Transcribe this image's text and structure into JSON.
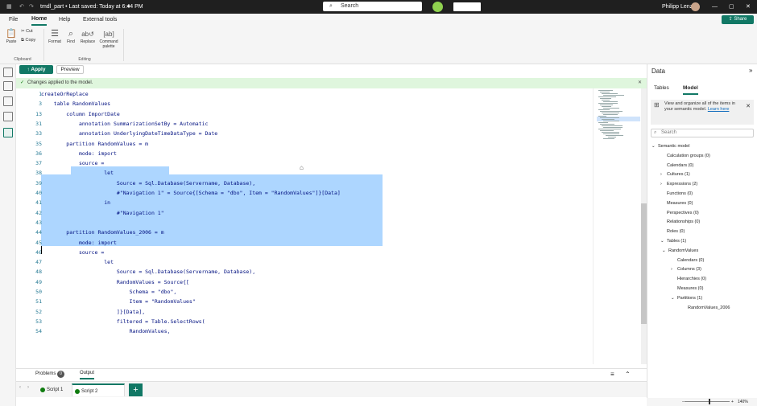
{
  "titlebar": {
    "doc_title": "tmdl_part • Last saved: Today at 6:44 PM",
    "search_placeholder": "Search",
    "user": "Philipp Lenz",
    "share": "Share"
  },
  "menu": [
    "File",
    "Home",
    "Help",
    "External tools"
  ],
  "ribbon": {
    "paste": "Paste",
    "cut": "Cut",
    "copy": "Copy",
    "format": "Format",
    "find": "Find",
    "replace": "Replace",
    "command_palette": "Command palette",
    "group_clipboard": "Clipboard",
    "group_editing": "Editing"
  },
  "toolbar": {
    "apply": "Apply",
    "preview": "Preview"
  },
  "banner": "Changes applied to the model.",
  "code_lines": [
    {
      "n": "1",
      "t": "createOrReplace"
    },
    {
      "n": "3",
      "t": "    table RandomValues"
    },
    {
      "n": "13",
      "t": "        column ImportDate"
    },
    {
      "n": "31",
      "t": "            annotation SummarizationSetBy = Automatic"
    },
    {
      "n": "33",
      "t": "            annotation UnderlyingDateTimeDataType = Date"
    },
    {
      "n": "35",
      "t": "        partition RandomValues = m"
    },
    {
      "n": "36",
      "t": "            mode: import"
    },
    {
      "n": "37",
      "t": "            source ="
    },
    {
      "n": "38",
      "t": "                    let"
    },
    {
      "n": "39",
      "t": "                        Source = Sql.Database(Servername, Database),"
    },
    {
      "n": "40",
      "t": "                        #\"Navigation 1\" = Source{[Schema = \"dbo\", Item = \"RandomValues\"]}[Data]"
    },
    {
      "n": "41",
      "t": "                    in"
    },
    {
      "n": "42",
      "t": "                        #\"Navigation 1\""
    },
    {
      "n": "43",
      "t": ""
    },
    {
      "n": "44",
      "t": "        partition RandomValues_2006 = m"
    },
    {
      "n": "45",
      "t": "            mode: import"
    },
    {
      "n": "46",
      "t": "            source ="
    },
    {
      "n": "47",
      "t": "                    let"
    },
    {
      "n": "48",
      "t": "                        Source = Sql.Database(Servername, Database),"
    },
    {
      "n": "49",
      "t": "                        RandomValues = Source{["
    },
    {
      "n": "50",
      "t": "                            Schema = \"dbo\","
    },
    {
      "n": "51",
      "t": "                            Item = \"RandomValues\""
    },
    {
      "n": "52",
      "t": "                        ]}[Data],"
    },
    {
      "n": "53",
      "t": "                        filtered = Table.SelectRows("
    },
    {
      "n": "54",
      "t": "                            RandomValues,"
    }
  ],
  "output_tabs": {
    "problems": "Problems",
    "problems_count": "0",
    "output": "Output"
  },
  "script_tabs": [
    "Script 1",
    "Script 2"
  ],
  "data_pane": {
    "title": "Data",
    "tab_tables": "Tables",
    "tab_model": "Model",
    "info": "View and organize all of the items in your semantic model.",
    "learn_here": "Learn here",
    "search_placeholder": "Search",
    "tree": [
      {
        "label": "Semantic model",
        "level": 0,
        "arrow": "v"
      },
      {
        "label": "Calculation groups (0)",
        "level": 1,
        "arrow": ""
      },
      {
        "label": "Calendars (0)",
        "level": 1,
        "arrow": ""
      },
      {
        "label": "Cultures (1)",
        "level": 1,
        "arrow": ">"
      },
      {
        "label": "Expressions (2)",
        "level": 1,
        "arrow": ">"
      },
      {
        "label": "Functions (0)",
        "level": 1,
        "arrow": ""
      },
      {
        "label": "Measures (0)",
        "level": 1,
        "arrow": ""
      },
      {
        "label": "Perspectives (0)",
        "level": 1,
        "arrow": ""
      },
      {
        "label": "Relationships (0)",
        "level": 1,
        "arrow": ""
      },
      {
        "label": "Roles (0)",
        "level": 1,
        "arrow": ""
      },
      {
        "label": "Tables (1)",
        "level": 1,
        "arrow": "v"
      },
      {
        "label": "RandomValues",
        "level": 2,
        "arrow": "v"
      },
      {
        "label": "Calendars (0)",
        "level": 3,
        "arrow": ""
      },
      {
        "label": "Columns (3)",
        "level": 3,
        "arrow": ">"
      },
      {
        "label": "Hierarchies (0)",
        "level": 3,
        "arrow": ""
      },
      {
        "label": "Measures (0)",
        "level": 3,
        "arrow": ""
      },
      {
        "label": "Partitions (1)",
        "level": 3,
        "arrow": "v"
      },
      {
        "label": "RandomValues_2006",
        "level": 4,
        "arrow": ""
      }
    ]
  },
  "status": {
    "zoom": "140%"
  },
  "colors": {
    "accent": "#117865",
    "selection": "#add6ff",
    "banner": "#dff6dd"
  }
}
